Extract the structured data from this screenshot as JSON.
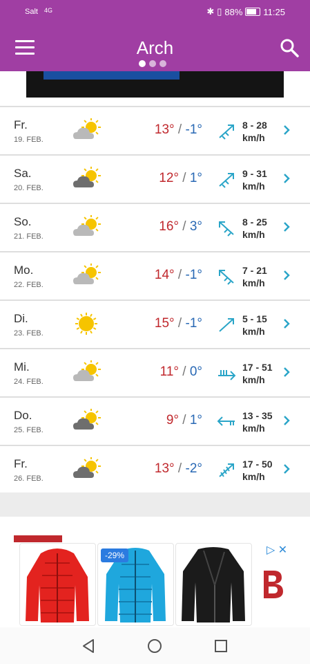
{
  "status_bar": {
    "carrier": "Salt",
    "network": "4G",
    "battery": "88%",
    "time": "11:25"
  },
  "header": {
    "title": "Arch"
  },
  "forecast": [
    {
      "day": "Fr.",
      "date": "19. FEB.",
      "icon": "partly-cloudy-light",
      "high": "13°",
      "low": "-1°",
      "wind_dir": "up-right-gust",
      "wind_range": "8 - 28",
      "wind_unit": "km/h"
    },
    {
      "day": "Sa.",
      "date": "20. FEB.",
      "icon": "partly-cloudy-dark",
      "high": "12°",
      "low": "1°",
      "wind_dir": "up-right-gust",
      "wind_range": "9 - 31",
      "wind_unit": "km/h"
    },
    {
      "day": "So.",
      "date": "21. FEB.",
      "icon": "partly-cloudy-light",
      "high": "16°",
      "low": "3°",
      "wind_dir": "up-left-gust",
      "wind_range": "8 - 25",
      "wind_unit": "km/h"
    },
    {
      "day": "Mo.",
      "date": "22. FEB.",
      "icon": "partly-cloudy-light",
      "high": "14°",
      "low": "-1°",
      "wind_dir": "up-left-gust",
      "wind_range": "7 - 21",
      "wind_unit": "km/h"
    },
    {
      "day": "Di.",
      "date": "23. FEB.",
      "icon": "sunny",
      "high": "15°",
      "low": "-1°",
      "wind_dir": "up-right",
      "wind_range": "5 - 15",
      "wind_unit": "km/h"
    },
    {
      "day": "Mi.",
      "date": "24. FEB.",
      "icon": "partly-cloudy-light",
      "high": "11°",
      "low": "0°",
      "wind_dir": "right-strong",
      "wind_range": "17 - 51",
      "wind_unit": "km/h"
    },
    {
      "day": "Do.",
      "date": "25. FEB.",
      "icon": "partly-cloudy-dark",
      "high": "9°",
      "low": "1°",
      "wind_dir": "left-gust",
      "wind_range": "13 - 35",
      "wind_unit": "km/h"
    },
    {
      "day": "Fr.",
      "date": "26. FEB.",
      "icon": "partly-cloudy-dark",
      "high": "13°",
      "low": "-2°",
      "wind_dir": "up-right-strong",
      "wind_range": "17 - 50",
      "wind_unit": "km/h"
    }
  ],
  "ad": {
    "discount": "-29%"
  },
  "colors": {
    "header": "#a03ea3",
    "high": "#c0282d",
    "low": "#2868b4",
    "accent": "#2aa5c8"
  }
}
